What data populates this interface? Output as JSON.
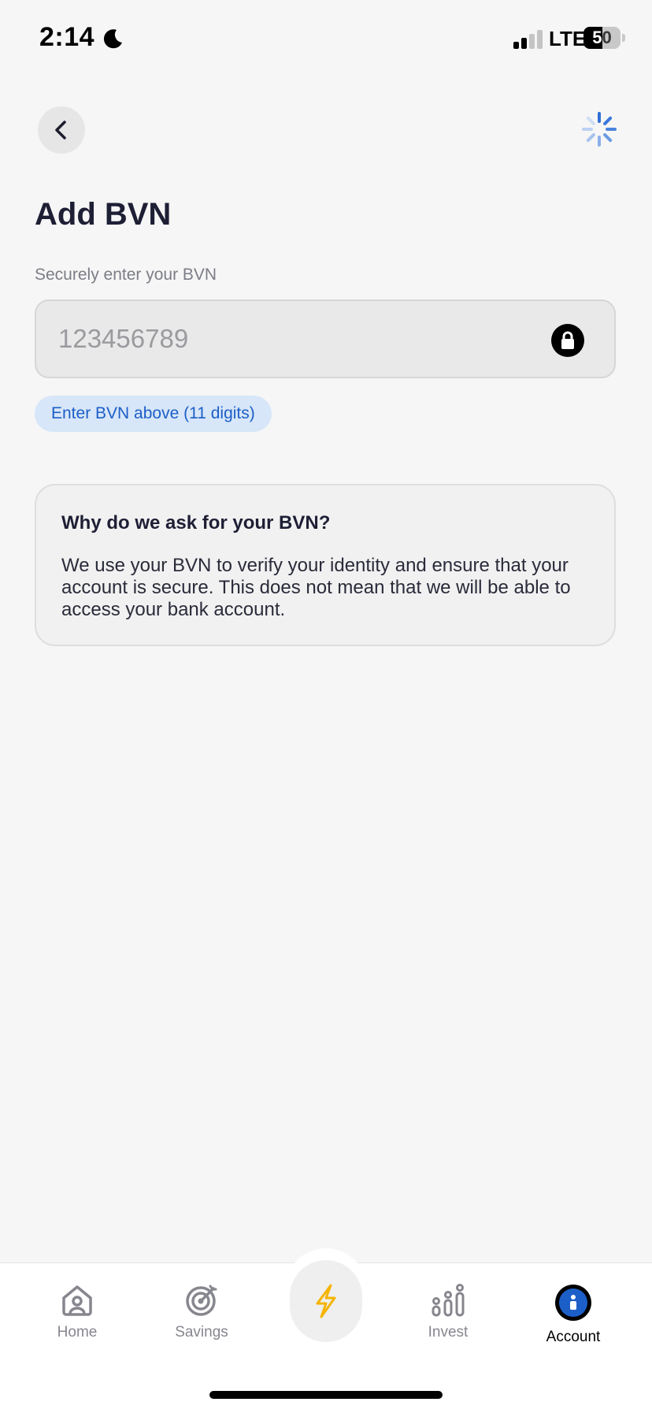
{
  "status_bar": {
    "time": "2:14",
    "network": "LTE",
    "battery": "50",
    "battery_level": 0.5
  },
  "header": {
    "back_icon": "chevron-left-icon",
    "loading_icon": "spinner-icon"
  },
  "page": {
    "title": "Add BVN",
    "field_label": "Securely enter your BVN",
    "bvn_placeholder": "123456789",
    "bvn_value": "",
    "hint": "Enter BVN above (11 digits)"
  },
  "info_card": {
    "title": "Why do we ask for your BVN?",
    "body": "We use your BVN to verify your identity and ensure that your account is secure. This does not mean that we will be able to access your bank account."
  },
  "bottom_nav": {
    "items": [
      {
        "label": "Home",
        "icon": "home-icon"
      },
      {
        "label": "Savings",
        "icon": "target-icon"
      },
      {
        "label": "",
        "icon": "lightning-icon"
      },
      {
        "label": "Invest",
        "icon": "invest-icon"
      },
      {
        "label": "Account",
        "icon": "account-icon",
        "active": true
      }
    ]
  },
  "colors": {
    "background": "#f6f6f6",
    "accent": "#1c5fc8",
    "hint_bg": "#d7e6f8",
    "lightning": "#f5b400"
  }
}
